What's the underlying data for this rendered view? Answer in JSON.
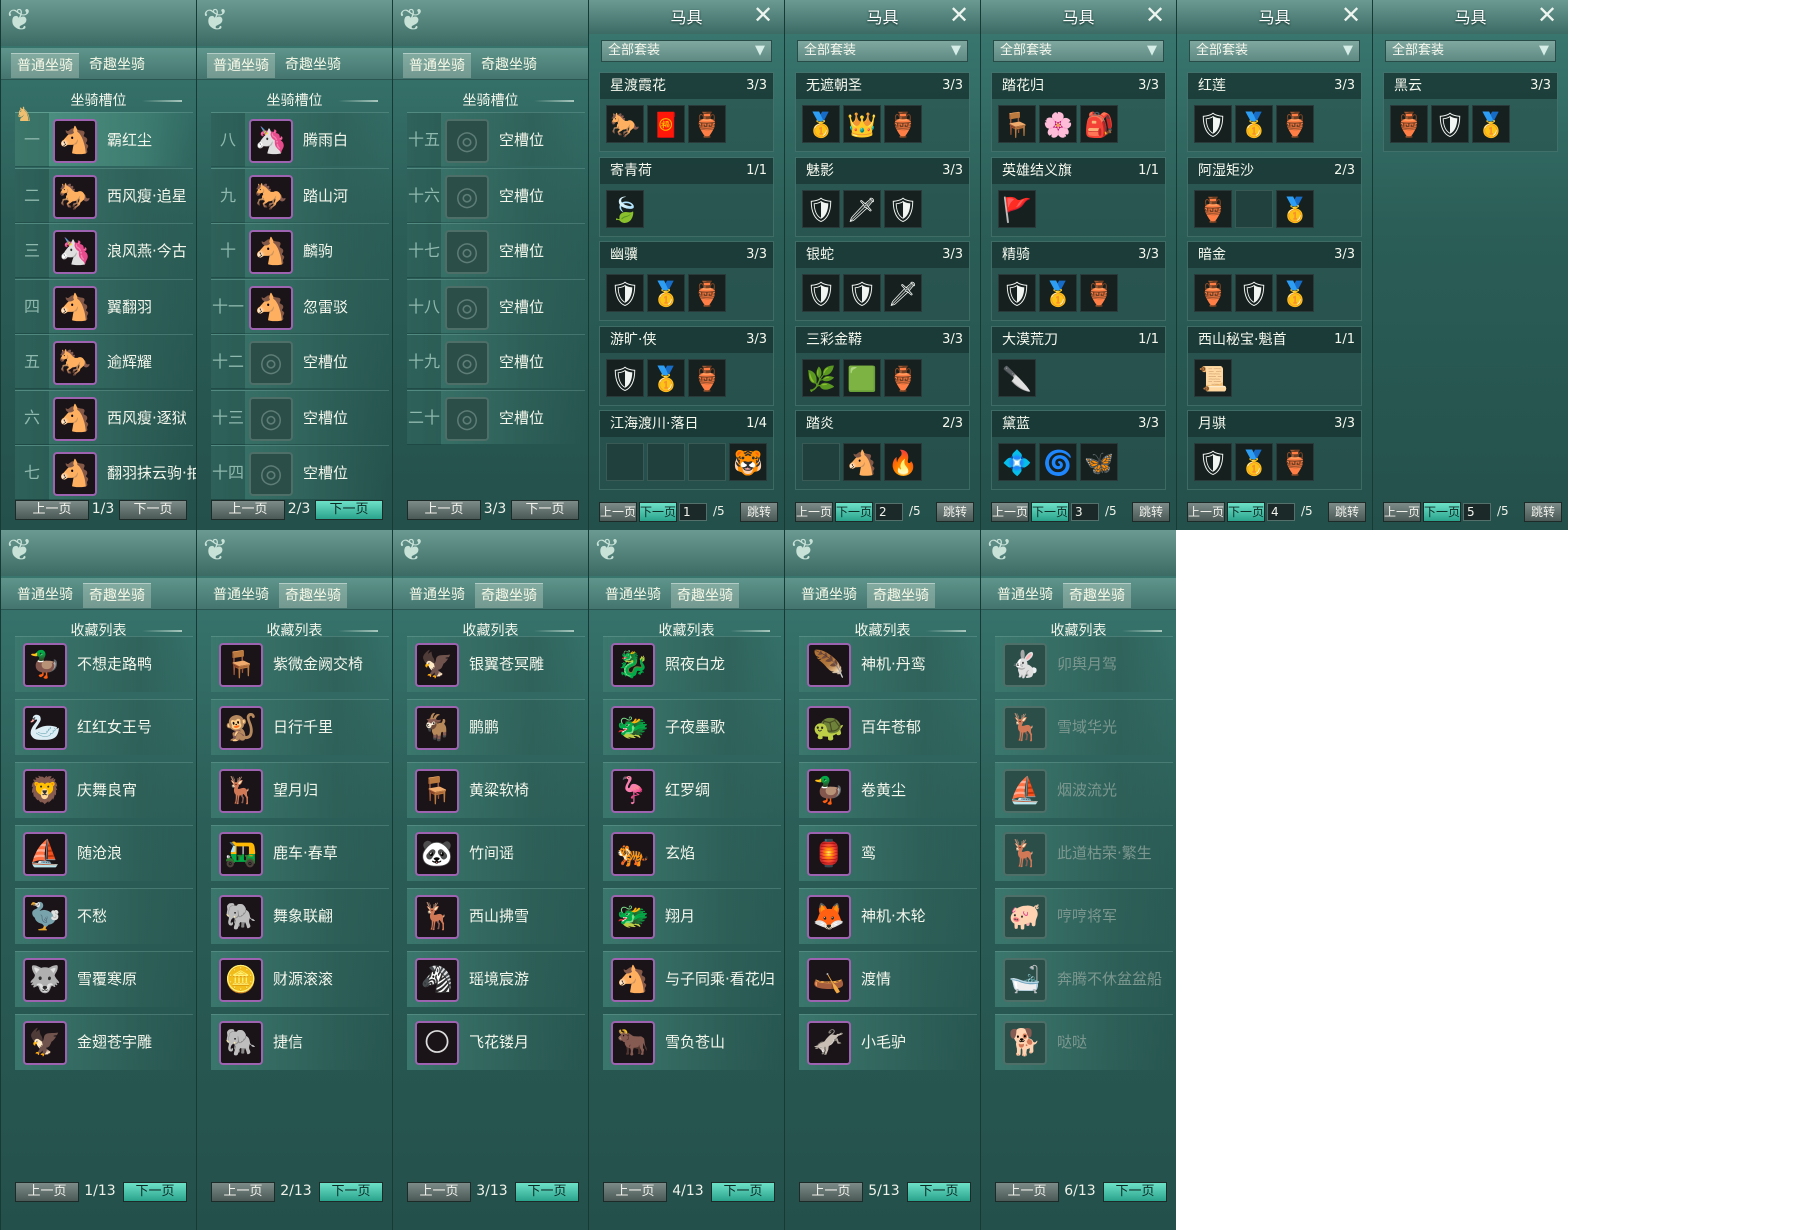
{
  "common": {
    "tab_normal": "普通坐骑",
    "tab_fun": "奇趣坐骑",
    "slots_title": "坐骑槽位",
    "collection_title": "收藏列表",
    "prev": "上一页",
    "next": "下一页",
    "harness_title": "马具",
    "all_sets": "全部套装",
    "jump": "跳转",
    "total_suffix": "/5",
    "close_glyph": "✕",
    "dropdown_glyph": "▼",
    "ornament_glyph": "❦",
    "crest_glyph": "♞"
  },
  "colors": {
    "panel_top": "#3a7a72",
    "panel_bottom": "#24504b",
    "accent_button": "#2aa38c",
    "purple_border": "#9d63b0"
  },
  "slot_pages": [
    {
      "indicator": "1/3",
      "next_highlighted": false,
      "rows": [
        {
          "num": "一",
          "name": "霸红尘",
          "icon": "🐴",
          "empty": false
        },
        {
          "num": "二",
          "name": "西风瘦·追星",
          "icon": "🐎",
          "empty": false
        },
        {
          "num": "三",
          "name": "浪风燕·今古",
          "icon": "🦄",
          "empty": false
        },
        {
          "num": "四",
          "name": "翼翻羽",
          "icon": "🐴",
          "empty": false
        },
        {
          "num": "五",
          "name": "逾辉耀",
          "icon": "🐎",
          "empty": false
        },
        {
          "num": "六",
          "name": "西风瘦·逐狱",
          "icon": "🐴",
          "empty": false
        },
        {
          "num": "七",
          "name": "翻羽抹云驹·拍尘",
          "icon": "🐴",
          "empty": false
        }
      ]
    },
    {
      "indicator": "2/3",
      "next_highlighted": true,
      "rows": [
        {
          "num": "八",
          "name": "腾雨白",
          "icon": "🦄",
          "empty": false
        },
        {
          "num": "九",
          "name": "踏山河",
          "icon": "🐎",
          "empty": false
        },
        {
          "num": "十",
          "name": "麟驹",
          "icon": "🐴",
          "empty": false
        },
        {
          "num": "十一",
          "name": "忽雷驳",
          "icon": "🐴",
          "empty": false
        },
        {
          "num": "十二",
          "name": "空槽位",
          "icon": "◎",
          "empty": true
        },
        {
          "num": "十三",
          "name": "空槽位",
          "icon": "◎",
          "empty": true
        },
        {
          "num": "十四",
          "name": "空槽位",
          "icon": "◎",
          "empty": true
        }
      ]
    },
    {
      "indicator": "3/3",
      "next_highlighted": false,
      "rows": [
        {
          "num": "十五",
          "name": "空槽位",
          "icon": "◎",
          "empty": true
        },
        {
          "num": "十六",
          "name": "空槽位",
          "icon": "◎",
          "empty": true
        },
        {
          "num": "十七",
          "name": "空槽位",
          "icon": "◎",
          "empty": true
        },
        {
          "num": "十八",
          "name": "空槽位",
          "icon": "◎",
          "empty": true
        },
        {
          "num": "十九",
          "name": "空槽位",
          "icon": "◎",
          "empty": true
        },
        {
          "num": "二十",
          "name": "空槽位",
          "icon": "◎",
          "empty": true
        }
      ]
    }
  ],
  "harness_pages": [
    {
      "page": "1",
      "sets": [
        {
          "name": "星渡霞花",
          "count": "3/3",
          "slots": [
            "🐎",
            "🧧",
            "🏺"
          ]
        },
        {
          "name": "寄青荷",
          "count": "1/1",
          "slots": [
            "🍃"
          ]
        },
        {
          "name": "幽骥",
          "count": "3/3",
          "slots": [
            "🛡",
            "🥇",
            "🏺"
          ]
        },
        {
          "name": "游旷·侠",
          "count": "3/3",
          "slots": [
            "🛡",
            "🥇",
            "🏺"
          ]
        },
        {
          "name": "江海渡川·落日",
          "count": "1/4",
          "slots": [
            "",
            "",
            "",
            "🐯"
          ]
        }
      ]
    },
    {
      "page": "2",
      "sets": [
        {
          "name": "无遮朝圣",
          "count": "3/3",
          "slots": [
            "🥇",
            "👑",
            "🏺"
          ]
        },
        {
          "name": "魅影",
          "count": "3/3",
          "slots": [
            "🛡",
            "🗡",
            "🛡"
          ]
        },
        {
          "name": "银蛇",
          "count": "3/3",
          "slots": [
            "🛡",
            "🛡",
            "🗡"
          ]
        },
        {
          "name": "三彩金鞯",
          "count": "3/3",
          "slots": [
            "🌿",
            "🟩",
            "🏺"
          ]
        },
        {
          "name": "踏炎",
          "count": "2/3",
          "slots": [
            "",
            "🐴",
            "🔥"
          ]
        }
      ]
    },
    {
      "page": "3",
      "sets": [
        {
          "name": "踏花归",
          "count": "3/3",
          "slots": [
            "🪑",
            "🌸",
            "🎒"
          ]
        },
        {
          "name": "英雄结义旗",
          "count": "1/1",
          "slots": [
            "🚩"
          ]
        },
        {
          "name": "精骑",
          "count": "3/3",
          "slots": [
            "🛡",
            "🥇",
            "🏺"
          ]
        },
        {
          "name": "大漠荒刀",
          "count": "1/1",
          "slots": [
            "🔪"
          ]
        },
        {
          "name": "黛蓝",
          "count": "3/3",
          "slots": [
            "💠",
            "🌀",
            "🦋"
          ]
        }
      ]
    },
    {
      "page": "4",
      "sets": [
        {
          "name": "红莲",
          "count": "3/3",
          "slots": [
            "🛡",
            "🥇",
            "🏺"
          ]
        },
        {
          "name": "阿湿矩沙",
          "count": "2/3",
          "slots": [
            "🏺",
            "",
            "🥇"
          ]
        },
        {
          "name": "暗金",
          "count": "3/3",
          "slots": [
            "🏺",
            "🛡",
            "🥇"
          ]
        },
        {
          "name": "西山秘宝·魁首",
          "count": "1/1",
          "slots": [
            "📜"
          ]
        },
        {
          "name": "月骐",
          "count": "3/3",
          "slots": [
            "🛡",
            "🥇",
            "🏺"
          ]
        }
      ]
    },
    {
      "page": "5",
      "sets": [
        {
          "name": "黑云",
          "count": "3/3",
          "slots": [
            "🏺",
            "🛡",
            "🥇"
          ]
        }
      ]
    }
  ],
  "collection_pages": [
    {
      "indicator": "1/13",
      "items": [
        {
          "name": "不想走路鸭",
          "icon": "🦆",
          "dim": false
        },
        {
          "name": "红红女王号",
          "icon": "🦢",
          "dim": false
        },
        {
          "name": "庆舞良宵",
          "icon": "🦁",
          "dim": false
        },
        {
          "name": "随沧浪",
          "icon": "⛵",
          "dim": false
        },
        {
          "name": "不愁",
          "icon": "🦤",
          "dim": false
        },
        {
          "name": "雪覆寒原",
          "icon": "🐺",
          "dim": false
        },
        {
          "name": "金翅苍宇雕",
          "icon": "🦅",
          "dim": false
        }
      ]
    },
    {
      "indicator": "2/13",
      "items": [
        {
          "name": "紫微金阙交椅",
          "icon": "🪑",
          "dim": false
        },
        {
          "name": "日行千里",
          "icon": "🐒",
          "dim": false
        },
        {
          "name": "望月归",
          "icon": "🦌",
          "dim": false
        },
        {
          "name": "鹿车·春草",
          "icon": "🛺",
          "dim": false
        },
        {
          "name": "舞象联翩",
          "icon": "🐘",
          "dim": false
        },
        {
          "name": "财源滚滚",
          "icon": "🪙",
          "dim": false
        },
        {
          "name": "捷信",
          "icon": "🐘",
          "dim": false
        }
      ]
    },
    {
      "indicator": "3/13",
      "items": [
        {
          "name": "银翼苍冥雕",
          "icon": "🦅",
          "dim": false
        },
        {
          "name": "鹏鹏",
          "icon": "🐐",
          "dim": false
        },
        {
          "name": "黄粱软椅",
          "icon": "🪑",
          "dim": false
        },
        {
          "name": "竹间谣",
          "icon": "🐼",
          "dim": false
        },
        {
          "name": "西山拂雪",
          "icon": "🦌",
          "dim": false
        },
        {
          "name": "瑶境宸游",
          "icon": "🦓",
          "dim": false
        },
        {
          "name": "飞花镂月",
          "icon": "🌕",
          "dim": false
        }
      ]
    },
    {
      "indicator": "4/13",
      "items": [
        {
          "name": "照夜白龙",
          "icon": "🐉",
          "dim": false
        },
        {
          "name": "子夜墨歌",
          "icon": "🐲",
          "dim": false
        },
        {
          "name": "红罗绸",
          "icon": "🦩",
          "dim": false
        },
        {
          "name": "玄焰",
          "icon": "🐅",
          "dim": false
        },
        {
          "name": "翔月",
          "icon": "🐲",
          "dim": false
        },
        {
          "name": "与子同乘·看花归",
          "icon": "🐴",
          "dim": false
        },
        {
          "name": "雪负苍山",
          "icon": "🐂",
          "dim": false
        }
      ]
    },
    {
      "indicator": "5/13",
      "items": [
        {
          "name": "神机·丹鸾",
          "icon": "🪶",
          "dim": false
        },
        {
          "name": "百年苍郁",
          "icon": "🐢",
          "dim": false
        },
        {
          "name": "卷黄尘",
          "icon": "🦆",
          "dim": false
        },
        {
          "name": "鸾",
          "icon": "🏮",
          "dim": false
        },
        {
          "name": "神机·木轮",
          "icon": "🦊",
          "dim": false
        },
        {
          "name": "渡情",
          "icon": "🛶",
          "dim": false
        },
        {
          "name": "小毛驴",
          "icon": "🫏",
          "dim": false
        }
      ]
    },
    {
      "indicator": "6/13",
      "items": [
        {
          "name": "卯舆月驾",
          "icon": "🐇",
          "dim": true
        },
        {
          "name": "雪域华光",
          "icon": "🦌",
          "dim": true
        },
        {
          "name": "烟波流光",
          "icon": "⛵",
          "dim": true
        },
        {
          "name": "此道枯荣·繁生",
          "icon": "🦌",
          "dim": true
        },
        {
          "name": "哼哼将军",
          "icon": "🐖",
          "dim": true
        },
        {
          "name": "奔腾不休盆盆船",
          "icon": "🛁",
          "dim": true
        },
        {
          "name": "哒哒",
          "icon": "🐕",
          "dim": true
        }
      ]
    }
  ]
}
